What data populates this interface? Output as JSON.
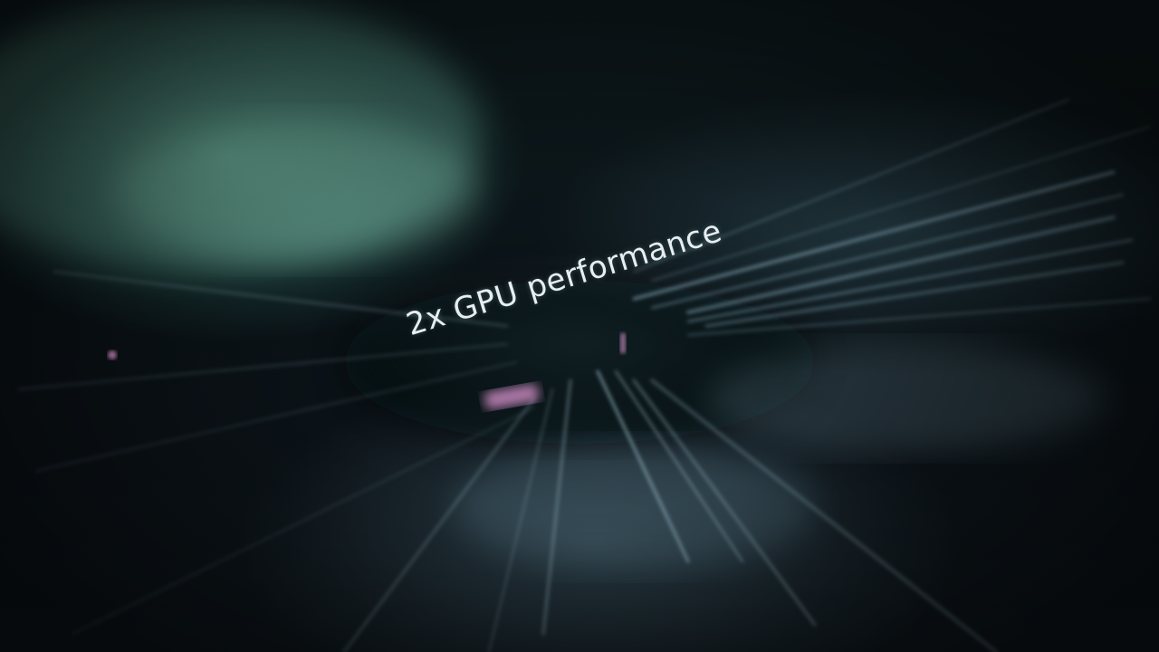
{
  "headline": "2x GPU performance",
  "colors": {
    "teal_glow": "#5faa96",
    "background": "#0a1216",
    "streak": "#a9d4e6",
    "pink_light": "#e59ad8",
    "text": "#e6eef2"
  }
}
